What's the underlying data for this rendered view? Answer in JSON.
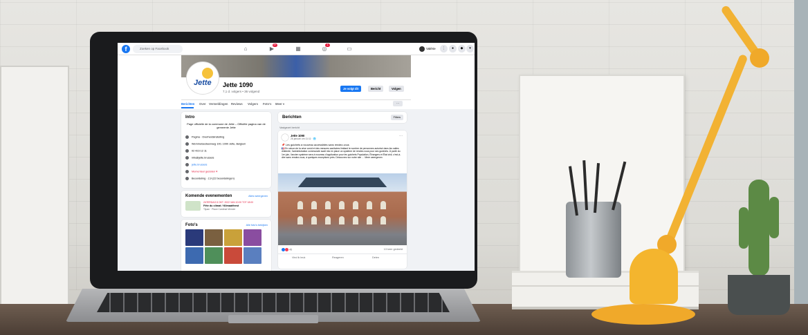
{
  "topbar": {
    "search_placeholder": "Zoeken op Facebook",
    "notif_badge_1": "9+",
    "notif_badge_2": "1",
    "user_name": "Valérie"
  },
  "page": {
    "name": "Jette 1090",
    "subtitle": "7,1 d. volgers • 36 volgend",
    "logo_text": "Jette",
    "buttons": {
      "follow": "Je volgt dit",
      "message": "Bericht",
      "search": "Volgen"
    },
    "tabs": [
      "Berichten",
      "Over",
      "Vermeldingen",
      "Reviews",
      "Volgers",
      "Foto's",
      "Meer ▾"
    ],
    "more": "···"
  },
  "intro": {
    "title": "Intro",
    "description": "Page officielle de la commune de Jette – Officiële pagina van de gemeente Jette",
    "rows": [
      "Pagina · Overheidsinstelling",
      "Wemmelsesteenweg 100, 1090 Jette, Belgium",
      "02 423 12 11",
      "info@jette.brussels",
      "jette.brussels",
      "Momenteel gesloten ▾",
      "Beoordeling · 2,9 (22 beoordelingen)"
    ]
  },
  "events": {
    "title": "Komende evenementen",
    "see_all": "Alles weergeven",
    "date": "ZATERDAG 8 OKT. 2022 VAN 10:00 TOT 18:00",
    "event_title": "Fête du climat / Klimaatfeest",
    "place": "Tijuan · Place Cardinal Mercier"
  },
  "photos": {
    "title": "Foto's",
    "see_all": "Alle foto's bekijken"
  },
  "posts": {
    "title": "Berichten",
    "filters": "Filters",
    "pinned": "Vastgezet bericht",
    "author": "Jette 1090",
    "date": "26 januari om 11:11 · 🌐",
    "headline": "📌 Les guichets à nouveau accessibles sans rendez-vous",
    "text": "🇫🇷 En raison de la crise covid et des mesures sanitaires limitant le nombre de personnes autorisé dans les salles d'attente, l'administration communale avait mis en place un système de rendez-vous pour ses guichets. À partir du 1er juin, l'ancien système sera à nouveau d'application pour les guichets Population, Étrangers et État civil, c'est-à-dire sans rendez-vous, à quelques exceptions près. Découvrez sur notre site … Meer weergeven",
    "reactions_count": "45",
    "shares": "13 keer gedeeld",
    "actions": [
      "Vind ik leuk",
      "Reageren",
      "Delen"
    ]
  }
}
